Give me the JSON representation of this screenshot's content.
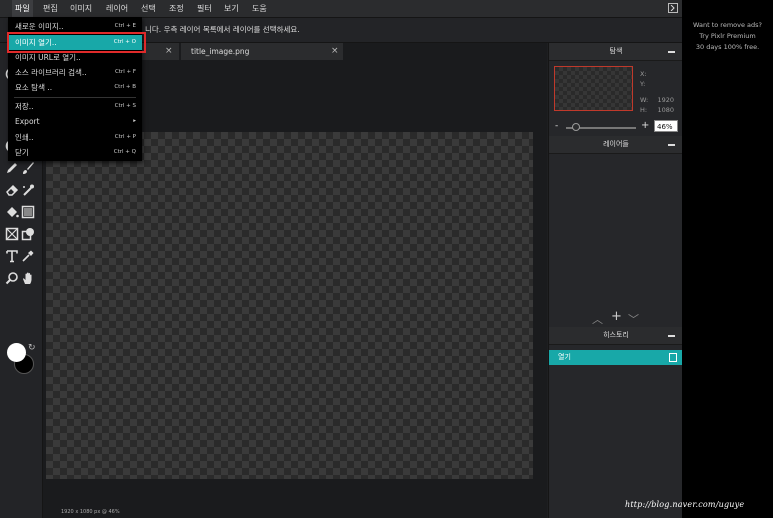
{
  "menubar": {
    "items": [
      "파일",
      "편집",
      "이미지",
      "레이어",
      "선택",
      "조정",
      "필터",
      "보기",
      "도움"
    ]
  },
  "options_bar": {
    "hint": "니다. 우측 레이어 목록에서 레이어를 선택하세요."
  },
  "file_menu": {
    "items": [
      {
        "label": "새로운 이미지..",
        "shortcut": "Ctrl + E"
      },
      {
        "label": "이미지 열기..",
        "shortcut": "Ctrl + O"
      },
      {
        "label": "이미지 URL로 열기..",
        "shortcut": ""
      },
      {
        "label": "소스 라이브러리 검색..",
        "shortcut": "Ctrl + F"
      },
      {
        "label": "요소 탐색 ..",
        "shortcut": "Ctrl + B"
      },
      {
        "label": "저장..",
        "shortcut": "Ctrl + S"
      },
      {
        "label": "Export",
        "shortcut": "▸"
      },
      {
        "label": "인쇄..",
        "shortcut": "Ctrl + P"
      },
      {
        "label": "닫기",
        "shortcut": "Ctrl + Q"
      }
    ],
    "highlighted": "이미지 열기.."
  },
  "tabs": [
    {
      "label": "title_image.png"
    }
  ],
  "status": {
    "text": "1920 x 1080 px @ 46%"
  },
  "navigator": {
    "title": "탐색",
    "x_label": "X:",
    "y_label": "Y:",
    "w_label": "W:",
    "w_value": "1920",
    "h_label": "H:",
    "h_value": "1080",
    "zoom_value": "46%",
    "zoom_fraction": 0.14
  },
  "layers": {
    "title": "레이어들"
  },
  "history": {
    "title": "히스토리",
    "items": [
      "열기"
    ]
  },
  "ad": {
    "line1": "Want to remove ads?",
    "line2": "Try Pixlr Premium",
    "line3": "30 days 100% free."
  },
  "watermark": "http://blog.naver.com/uguye",
  "colors": {
    "accent": "#18a8a8",
    "highlight_box": "#e02a2a",
    "foreground": "#ffffff",
    "background": "#000000"
  },
  "icons": [
    "fullscreen-icon",
    "circle-tool-icon",
    "blur-icon",
    "brush-icon",
    "pencil-icon",
    "eraser-icon",
    "clone-icon",
    "bucket-icon",
    "gradient-icon",
    "crop-box-icon",
    "shape-icon",
    "text-icon",
    "eyedropper-icon",
    "zoom-icon",
    "hand-icon",
    "swap-icon"
  ]
}
